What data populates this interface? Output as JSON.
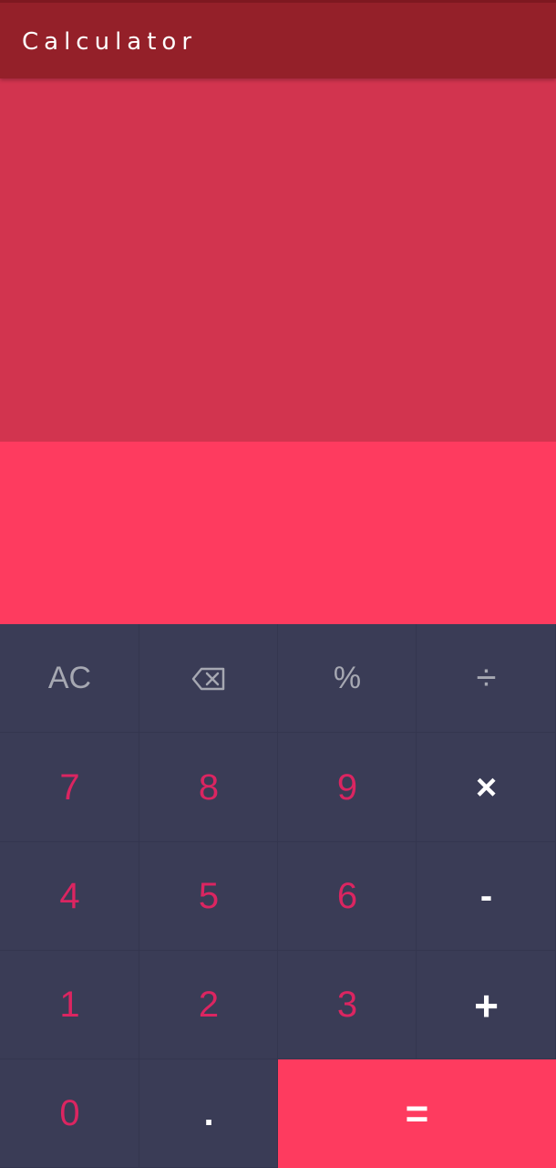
{
  "app": {
    "title": "Calculator"
  },
  "display": {
    "history_text": "",
    "current_value": ""
  },
  "keypad": {
    "row1": {
      "clear": "AC",
      "backspace_icon": "backspace-icon",
      "percent": "%",
      "divide": "÷"
    },
    "row2": {
      "seven": "7",
      "eight": "8",
      "nine": "9",
      "multiply": "×"
    },
    "row3": {
      "four": "4",
      "five": "5",
      "six": "6",
      "subtract": "-"
    },
    "row4": {
      "one": "1",
      "two": "2",
      "three": "3",
      "add": "+"
    },
    "row5": {
      "zero": "0",
      "decimal": ".",
      "equals": "="
    }
  },
  "colors": {
    "topbar": "#942029",
    "history_bg": "#d2344f",
    "display_bg": "#fe3b5f",
    "keypad_bg": "#3a3c56",
    "number_text": "#db2561",
    "function_text": "#a6a8b2",
    "operator_text": "#ffffff",
    "equals_bg": "#fe3b5f"
  }
}
